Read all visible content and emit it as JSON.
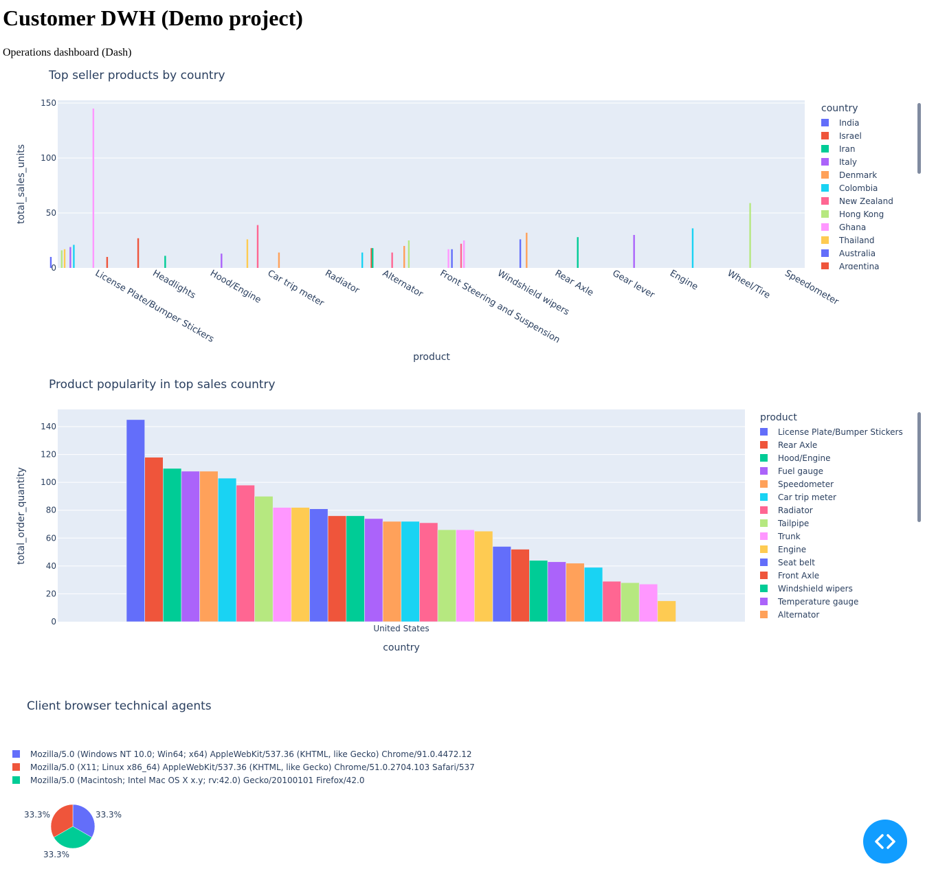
{
  "page": {
    "title": "Customer DWH (Demo project)",
    "subtitle": "Operations dashboard (Dash)"
  },
  "palette": [
    "#636efa",
    "#EF553B",
    "#00cc96",
    "#ab63fa",
    "#FFA15A",
    "#19d3f3",
    "#FF6692",
    "#B6E880",
    "#FF97FF",
    "#FECB52"
  ],
  "chart_data": [
    {
      "id": "top-seller",
      "type": "bar",
      "title": "Top seller products by country",
      "xlabel": "product",
      "ylabel": "total_sales_units",
      "ylim": [
        0,
        150
      ],
      "yticks": [
        0,
        50,
        100,
        150
      ],
      "grid": true,
      "legend_title": "country",
      "legend_placement": "right",
      "legend_visible": [
        "India",
        "Israel",
        "Iran",
        "Italy",
        "Denmark",
        "Colombia",
        "New Zealand",
        "Hong Kong",
        "Ghana",
        "Thailand",
        "Australia",
        "Argentina"
      ],
      "categories": [
        "License Plate/Bumper Stickers",
        "Headlights",
        "Hood/Engine",
        "Car trip meter",
        "Radiator",
        "Alternator",
        "Front Steering and Suspension",
        "Windshield wipers",
        "Rear Axle",
        "Gear lever",
        "Engine",
        "Wheel/Tire",
        "Speedometer"
      ],
      "bars": [
        {
          "category_index": 0,
          "offset": -0.62,
          "color_index": 0,
          "value": 10
        },
        {
          "category_index": 0,
          "offset": -0.43,
          "color_index": 7,
          "value": 16
        },
        {
          "category_index": 0,
          "offset": -0.38,
          "color_index": 9,
          "value": 17
        },
        {
          "category_index": 0,
          "offset": -0.28,
          "color_index": 3,
          "value": 19
        },
        {
          "category_index": 0,
          "offset": -0.22,
          "color_index": 5,
          "value": 21
        },
        {
          "category_index": 0,
          "offset": 0.12,
          "color_index": 8,
          "value": 145
        },
        {
          "category_index": 0,
          "offset": 0.36,
          "color_index": 1,
          "value": 10
        },
        {
          "category_index": 1,
          "offset": -0.1,
          "color_index": 1,
          "value": 27
        },
        {
          "category_index": 2,
          "offset": -0.63,
          "color_index": 2,
          "value": 11
        },
        {
          "category_index": 2,
          "offset": 0.35,
          "color_index": 3,
          "value": 13
        },
        {
          "category_index": 3,
          "offset": -0.2,
          "color_index": 9,
          "value": 26
        },
        {
          "category_index": 3,
          "offset": -0.02,
          "color_index": 6,
          "value": 39
        },
        {
          "category_index": 3,
          "offset": 0.35,
          "color_index": 4,
          "value": 14
        },
        {
          "category_index": 5,
          "offset": -0.2,
          "color_index": 5,
          "value": 14
        },
        {
          "category_index": 5,
          "offset": -0.04,
          "color_index": 1,
          "value": 18
        },
        {
          "category_index": 5,
          "offset": -0.02,
          "color_index": 2,
          "value": 18
        },
        {
          "category_index": 6,
          "offset": -0.68,
          "color_index": 6,
          "value": 14
        },
        {
          "category_index": 6,
          "offset": -0.47,
          "color_index": 4,
          "value": 20
        },
        {
          "category_index": 6,
          "offset": -0.39,
          "color_index": 7,
          "value": 25
        },
        {
          "category_index": 7,
          "offset": -0.7,
          "color_index": 8,
          "value": 17
        },
        {
          "category_index": 7,
          "offset": -0.64,
          "color_index": 0,
          "value": 17
        },
        {
          "category_index": 7,
          "offset": -0.48,
          "color_index": 6,
          "value": 22
        },
        {
          "category_index": 7,
          "offset": -0.43,
          "color_index": 8,
          "value": 25
        },
        {
          "category_index": 8,
          "offset": -0.45,
          "color_index": 0,
          "value": 26
        },
        {
          "category_index": 8,
          "offset": -0.34,
          "color_index": 4,
          "value": 32
        },
        {
          "category_index": 9,
          "offset": -0.45,
          "color_index": 2,
          "value": 28
        },
        {
          "category_index": 10,
          "offset": -0.47,
          "color_index": 3,
          "value": 30
        },
        {
          "category_index": 11,
          "offset": -0.45,
          "color_index": 5,
          "value": 36
        },
        {
          "category_index": 12,
          "offset": -0.45,
          "color_index": 7,
          "value": 59
        }
      ]
    },
    {
      "id": "popularity",
      "type": "bar",
      "title": "Product popularity in top sales country",
      "xlabel": "country",
      "ylabel": "total_order_quantity",
      "ylim": [
        0,
        152
      ],
      "yticks": [
        0,
        20,
        40,
        60,
        80,
        100,
        120,
        140
      ],
      "grid": true,
      "categories": [
        "United States"
      ],
      "legend_title": "product",
      "legend_placement": "right",
      "legend_visible": [
        "License Plate/Bumper Stickers",
        "Rear Axle",
        "Hood/Engine",
        "Fuel gauge",
        "Speedometer",
        "Car trip meter",
        "Radiator",
        "Tailpipe",
        "Trunk",
        "Engine",
        "Seat belt",
        "Front Axle",
        "Windshield wipers",
        "Temperature gauge",
        "Alternator"
      ],
      "values": [
        145,
        118,
        110,
        108,
        108,
        103,
        98,
        90,
        82,
        82,
        81,
        76,
        76,
        74,
        72,
        72,
        71,
        66,
        66,
        65,
        54,
        52,
        44,
        43,
        42,
        39,
        29,
        28,
        27,
        15
      ]
    },
    {
      "id": "agents",
      "type": "pie",
      "title": "Client browser technical agents",
      "labels": [
        "Mozilla/5.0 (Windows NT 10.0; Win64; x64) AppleWebKit/537.36 (KHTML, like Gecko) Chrome/91.0.4472.12",
        "Mozilla/5.0 (X11; Linux x86_64) AppleWebKit/537.36 (KHTML, like Gecko) Chrome/51.0.2704.103 Safari/537",
        "Mozilla/5.0 (Macintosh; Intel Mac OS X x.y; rv:42.0) Gecko/20100101 Firefox/42.0"
      ],
      "values": [
        33.3,
        33.3,
        33.3
      ],
      "text_labels": [
        "33.3%",
        "33.3%",
        "33.3%"
      ],
      "colors": [
        "#636efa",
        "#EF553B",
        "#00cc96"
      ]
    }
  ],
  "fab": {
    "icon": "code-brackets-icon"
  }
}
